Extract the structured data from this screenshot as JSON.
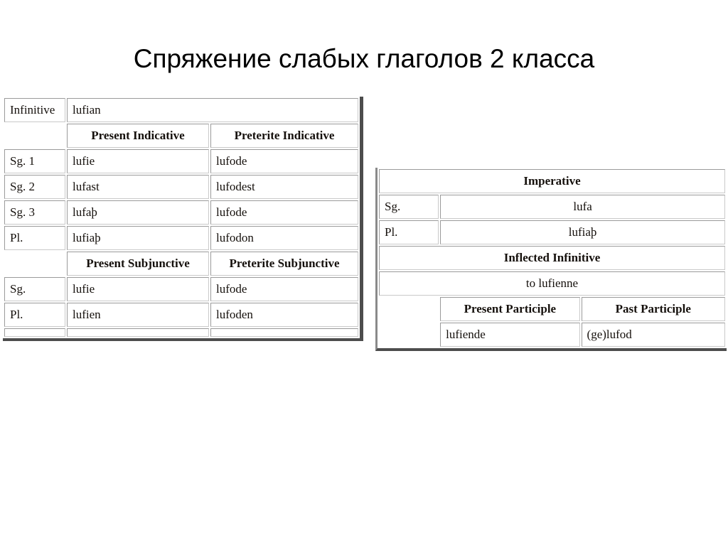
{
  "title": "Спряжение слабых глаголов 2 класса",
  "left_table": {
    "infinitive_label": "Infinitive",
    "infinitive_value": "lufian",
    "indicative_headers": {
      "present": "Present Indicative",
      "preterite": "Preterite Indicative"
    },
    "indicative_rows": [
      {
        "person": "Sg. 1",
        "present": "lufie",
        "preterite": "lufode"
      },
      {
        "person": "Sg. 2",
        "present": "lufast",
        "preterite": "lufodest"
      },
      {
        "person": "Sg. 3",
        "present": "lufaþ",
        "preterite": "lufode"
      },
      {
        "person": "Pl.",
        "present": "lufiaþ",
        "preterite": "lufodon"
      }
    ],
    "subjunctive_headers": {
      "present": "Present Subjunctive",
      "preterite": "Preterite Subjunctive"
    },
    "subjunctive_rows": [
      {
        "person": "Sg.",
        "present": "lufie",
        "preterite": "lufode"
      },
      {
        "person": "Pl.",
        "present": "lufien",
        "preterite": "lufoden"
      }
    ]
  },
  "right_table": {
    "imperative_header": "Imperative",
    "imperative_rows": [
      {
        "person": "Sg.",
        "form": "lufa"
      },
      {
        "person": "Pl.",
        "form": "lufiaþ"
      }
    ],
    "inflected_infinitive_header": "Inflected Infinitive",
    "inflected_infinitive_value": "to lufienne",
    "participle_headers": {
      "present": "Present Participle",
      "past": "Past Participle"
    },
    "participles": {
      "present": "lufiende",
      "past": "(ge)lufod"
    }
  },
  "colors": {
    "page_background": "#ffffff",
    "text": "#15100c",
    "cell_border": "#c9c9c9",
    "table_edge": "#4d4d4d"
  }
}
